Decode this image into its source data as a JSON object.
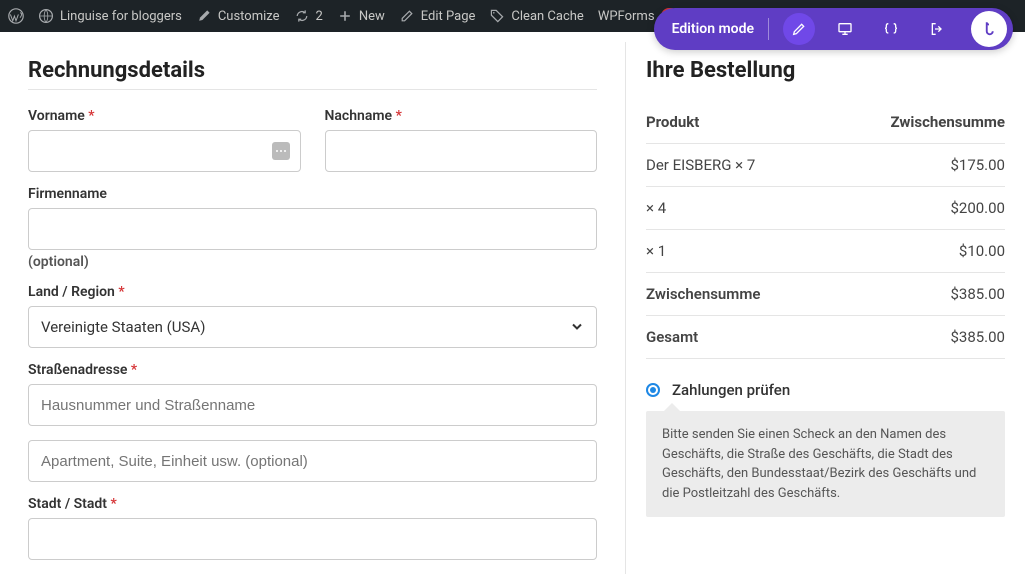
{
  "adminbar": {
    "site_name": "Linguise for bloggers",
    "customize": "Customize",
    "updates": "2",
    "new": "New",
    "edit_page": "Edit Page",
    "clean_cache": "Clean Cache",
    "wpforms": "WPForms",
    "wpforms_badge": "4"
  },
  "edition": {
    "label": "Edition mode"
  },
  "billing": {
    "heading": "Rechnungsdetails",
    "first_name_label": "Vorname",
    "last_name_label": "Nachname",
    "company_label": "Firmenname",
    "optional_label": "(optional)",
    "country_label": "Land / Region",
    "country_value": "Vereinigte Staaten (USA)",
    "street_label": "Straßenadresse",
    "street_placeholder": "Hausnummer und Straßenname",
    "street2_placeholder": "Apartment, Suite, Einheit usw. (optional)",
    "city_label": "Stadt / Stadt"
  },
  "order": {
    "heading": "Ihre Bestellung",
    "col_product": "Produkt",
    "col_subtotal": "Zwischensumme",
    "items": [
      {
        "name": "Der EISBERG × 7",
        "price": "$175.00"
      },
      {
        "name": " × 4",
        "price": "$200.00"
      },
      {
        "name": " × 1",
        "price": "$10.00"
      }
    ],
    "subtotal_label": "Zwischensumme",
    "subtotal_value": "$385.00",
    "total_label": "Gesamt",
    "total_value": "$385.00",
    "payment_label": "Zahlungen prüfen",
    "payment_desc": "Bitte senden Sie einen Scheck an den Namen des Geschäfts, die Straße des Geschäfts, die Stadt des Geschäfts, den Bundesstaat/Bezirk des Geschäfts und die Postleitzahl des Geschäfts."
  }
}
